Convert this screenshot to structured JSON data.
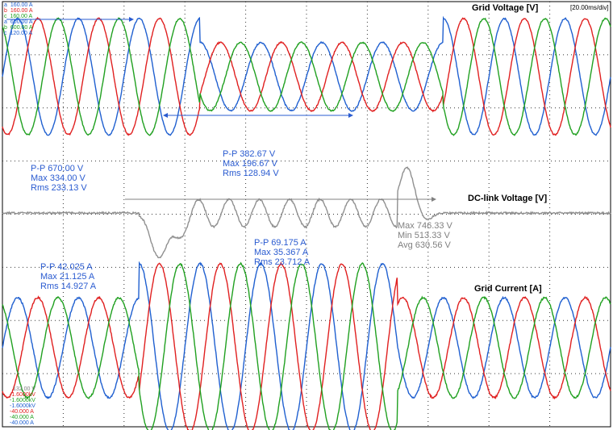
{
  "scope": {
    "timebase": "[20.00ms/div]",
    "frame_color": "#000000",
    "grid_color": "#333333"
  },
  "colors": {
    "phase_a": "#2060d0",
    "phase_b": "#e02020",
    "phase_c": "#20a020",
    "dc": "#909090",
    "meas_blue": "#2a5bd0",
    "meas_gray": "#808080"
  },
  "scale_top": {
    "lines": [
      {
        "prefix": "a",
        "value": "160.00 A",
        "color": "#2060d0"
      },
      {
        "prefix": "b",
        "value": "160.00 A",
        "color": "#e02020"
      },
      {
        "prefix": "c",
        "value": "160.00 A",
        "color": "#20a020"
      },
      {
        "prefix": "a",
        "value": "600.00 A",
        "color": "#2060d0"
      },
      {
        "prefix": "b",
        "value": "600.00 A",
        "color": "#20a020"
      },
      {
        "prefix": "c",
        "value": "120.00 A",
        "color": "#2060d0"
      }
    ]
  },
  "scale_bottom": {
    "lines": [
      {
        "value": "132.00 V",
        "color": "#808080"
      },
      {
        "value": "-1.6000kV",
        "color": "#e02020"
      },
      {
        "value": "-1.6000kV",
        "color": "#20a020"
      },
      {
        "value": "-1.6000kV",
        "color": "#2060d0"
      },
      {
        "value": "-40.000 A",
        "color": "#e02020"
      },
      {
        "value": "-40.000 A",
        "color": "#20a020"
      },
      {
        "value": "-40.000 A",
        "color": "#2060d0"
      }
    ]
  },
  "chart_data": [
    {
      "type": "line",
      "title": "Grid Voltage [V]",
      "x_unit": "ms",
      "x_range": [
        0,
        200
      ],
      "series_phases_deg": [
        0,
        -120,
        120
      ],
      "segments": [
        {
          "t_start": 0,
          "t_end": 65,
          "amplitude_V": 335
        },
        {
          "t_start": 65,
          "t_end": 145,
          "amplitude_V": 197
        },
        {
          "t_start": 145,
          "t_end": 200,
          "amplitude_V": 335
        }
      ],
      "frequency_Hz": 50,
      "measurements": [
        {
          "lines": [
            "P-P  670.00 V",
            "Max  334.00 V",
            "Rms  233.13 V"
          ],
          "color": "#2a5bd0"
        },
        {
          "lines": [
            "P-P  382.67 V",
            "Max  196.67 V",
            "Rms  128.94 V"
          ],
          "color": "#2a5bd0"
        }
      ]
    },
    {
      "type": "line",
      "title": "DC-link Voltage [V]",
      "x_unit": "ms",
      "nominal_V": 630,
      "dip_min_V": 513,
      "peak_max_V": 746,
      "ripple_start_ms": 45,
      "ripple_end_ms": 130,
      "ripple_frequency_Hz": 100,
      "measurements": [
        {
          "lines": [
            "Max  746.33 V",
            "Min  513.33 V",
            "Avg  630.56 V"
          ],
          "color": "#808080"
        }
      ]
    },
    {
      "type": "line",
      "title": "Grid Current [A]",
      "x_unit": "ms",
      "series_phases_deg": [
        0,
        -120,
        120
      ],
      "segments": [
        {
          "t_start": 0,
          "t_end": 45,
          "amplitude_A": 21.1
        },
        {
          "t_start": 45,
          "t_end": 130,
          "amplitude_A": 35.4
        },
        {
          "t_start": 130,
          "t_end": 200,
          "amplitude_A": 21.1
        }
      ],
      "frequency_Hz": 50,
      "measurements": [
        {
          "lines": [
            "P-P  42.025 A",
            "Max  21.125 A",
            "Rms  14.927 A"
          ],
          "color": "#2a5bd0"
        },
        {
          "lines": [
            "P-P  69.175 A",
            "Max  35.367 A",
            "Rms  23.712 A"
          ],
          "color": "#2a5bd0"
        }
      ]
    }
  ]
}
